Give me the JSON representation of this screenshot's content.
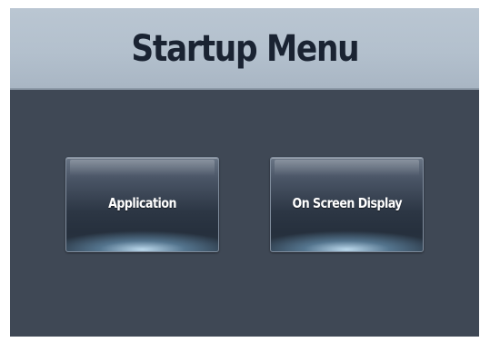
{
  "header": {
    "title": "Startup Menu"
  },
  "buttons": [
    {
      "label": "Application"
    },
    {
      "label": "On Screen Display"
    }
  ],
  "colors": {
    "background": "#3f4855",
    "header": "#b3c0cd",
    "title_text": "#1a2332",
    "button_text": "#ffffff",
    "button_glow": "#c3e1f5"
  }
}
